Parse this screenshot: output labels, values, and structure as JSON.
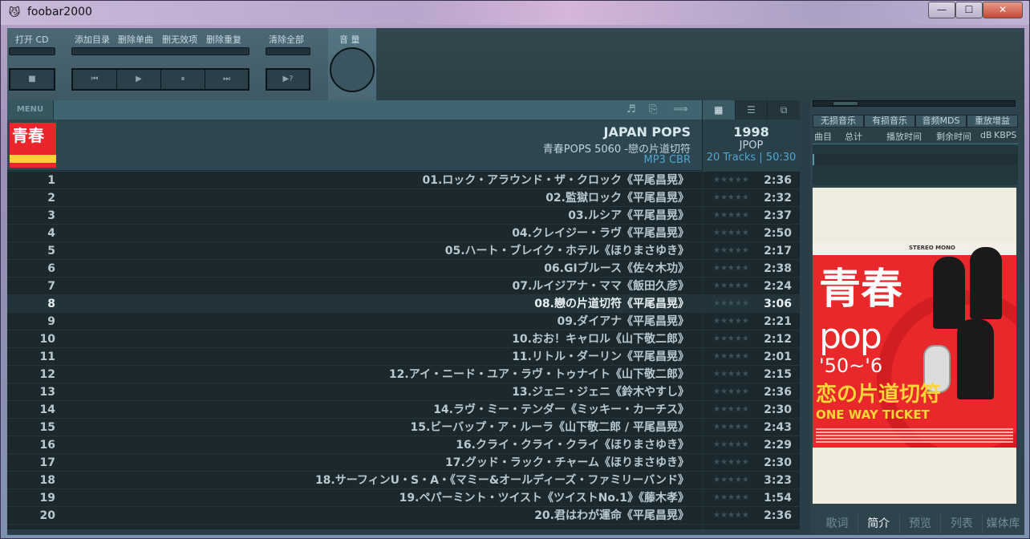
{
  "window": {
    "title": "foobar2000",
    "icon": "foobar-cat-icon",
    "min": "—",
    "max": "☐",
    "close": "✕"
  },
  "toolbar": {
    "open_cd": "打开 CD",
    "add_folder": "添加目录",
    "remove_single": "删除单曲",
    "remove_invalid": "删无效项",
    "remove_duplicates": "删除重复",
    "clear_all": "清除全部",
    "volume": "音 量",
    "stop": "■",
    "prev": "⏮",
    "play": "▶",
    "pause": "⏸",
    "next": "⏭",
    "random": "▶?"
  },
  "menubar": {
    "menu_label": "MENU",
    "icons": [
      "♬",
      "⎘",
      "⟹"
    ]
  },
  "view_tabs": [
    {
      "label": "▦",
      "active": true
    },
    {
      "label": "☰",
      "active": false
    },
    {
      "label": "⧉",
      "active": false
    }
  ],
  "album": {
    "artist": "JAPAN POPS",
    "title": "青春POPS 5060 -戀の片道切符",
    "format": "MP3 CBR",
    "year": "1998",
    "genre": "JPOP",
    "count": "20 Tracks | 50:30",
    "thumb_text": "青春"
  },
  "tracks": [
    {
      "num": "1",
      "title": "01.ロック・アラウンド・ザ・クロック《平尾昌晃》",
      "rating": "★★★★★",
      "duration": "2:36"
    },
    {
      "num": "2",
      "title": "02.監獄ロック《平尾昌晃》",
      "rating": "★★★★★",
      "duration": "2:32"
    },
    {
      "num": "3",
      "title": "03.ルシア《平尾昌晃》",
      "rating": "★★★★★",
      "duration": "2:37"
    },
    {
      "num": "4",
      "title": "04.クレイジー・ラヴ《平尾昌晃》",
      "rating": "★★★★★",
      "duration": "2:50"
    },
    {
      "num": "5",
      "title": "05.ハート・ブレイク・ホテル《ほりまさゆき》",
      "rating": "★★★★★",
      "duration": "2:17"
    },
    {
      "num": "6",
      "title": "06.GIブルース《佐々木功》",
      "rating": "★★★★★",
      "duration": "2:38"
    },
    {
      "num": "7",
      "title": "07.ルイジアナ・ママ《飯田久彦》",
      "rating": "★★★★★",
      "duration": "2:24"
    },
    {
      "num": "8",
      "title": "08.戀の片道切符《平尾昌晃》",
      "rating": "★★★★★",
      "duration": "3:06",
      "current": true
    },
    {
      "num": "9",
      "title": "09.ダイアナ《平尾昌晃》",
      "rating": "★★★★★",
      "duration": "2:21"
    },
    {
      "num": "10",
      "title": "10.おお！キャロル《山下敬二郎》",
      "rating": "★★★★★",
      "duration": "2:12"
    },
    {
      "num": "11",
      "title": "11.リトル・ダーリン《平尾昌晃》",
      "rating": "★★★★★",
      "duration": "2:01"
    },
    {
      "num": "12",
      "title": "12.アイ・ニード・ユア・ラヴ・トゥナイト《山下敬二郎》",
      "rating": "★★★★★",
      "duration": "2:15"
    },
    {
      "num": "13",
      "title": "13.ジェニ・ジェニ《鈴木やすし》",
      "rating": "★★★★★",
      "duration": "2:36"
    },
    {
      "num": "14",
      "title": "14.ラヴ・ミー・テンダー《ミッキー・カーチス》",
      "rating": "★★★★★",
      "duration": "2:30"
    },
    {
      "num": "15",
      "title": "15.ビーバップ・ア・ルーラ《山下敬二郎 / 平尾昌晃》",
      "rating": "★★★★★",
      "duration": "2:43"
    },
    {
      "num": "16",
      "title": "16.クライ・クライ・クライ《ほりまさゆき》",
      "rating": "★★★★★",
      "duration": "2:29"
    },
    {
      "num": "17",
      "title": "17.グッド・ラック・チャーム《ほりまさゆき》",
      "rating": "★★★★★",
      "duration": "2:30"
    },
    {
      "num": "18",
      "title": "18.サーフィンU・S・A・《マミー&オールディーズ・ファミリーバンド》",
      "rating": "★★★★★",
      "duration": "3:23"
    },
    {
      "num": "19",
      "title": "19.ペパーミント・ツイスト《ツイストNo.1》《藤木孝》",
      "rating": "★★★★★",
      "duration": "1:54"
    },
    {
      "num": "20",
      "title": "20.君はわが運命《平尾昌晃》",
      "rating": "★★★★★",
      "duration": "2:36"
    }
  ],
  "right_panel": {
    "tabs": [
      "无损音乐",
      "有损音乐",
      "音频MDS",
      "重放增益"
    ],
    "columns": {
      "track": "曲目",
      "total": "总计",
      "play_time": "播放时间",
      "remaining": "剩余时间",
      "db": "dB",
      "kbps": "KBPS"
    },
    "cover": {
      "top_strip": "STEREO MONO",
      "kanji": "青春",
      "pops": "pop",
      "era": "'50~'6",
      "jp_title": "恋の片道切符",
      "en_title": "ONE WAY TICKET"
    },
    "bottom_tabs": [
      {
        "label": "歌词",
        "active": false
      },
      {
        "label": "简介",
        "active": true
      },
      {
        "label": "预览",
        "active": false
      },
      {
        "label": "列表",
        "active": false
      },
      {
        "label": "媒体库",
        "active": false
      }
    ]
  }
}
